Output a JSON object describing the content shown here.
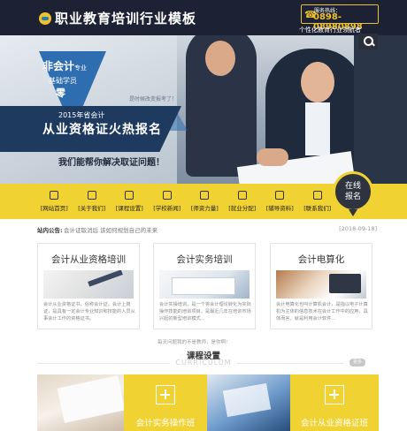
{
  "header": {
    "logo_text": "职业教育培训行业模板",
    "hotline_label": "服务热线：",
    "hotline_number": "0898-08980898",
    "tagline": "个性化教育行业领航者"
  },
  "banner": {
    "tri_line1_main": "非会计",
    "tri_line1_small": "专业",
    "tri_line2": "基础学员",
    "tri_line3": "零",
    "note": "是时候改变报考了！",
    "band_line1": "2015年省会计",
    "band_line2": "从业资格证火热报名",
    "help_text": "我们能帮你解决取证问题！"
  },
  "nav": {
    "items": [
      {
        "label": "[网站首页]",
        "icon": "home-icon"
      },
      {
        "label": "[关于我们]",
        "icon": "info-icon"
      },
      {
        "label": "[课程设置]",
        "icon": "book-icon"
      },
      {
        "label": "[学校新闻]",
        "icon": "news-icon"
      },
      {
        "label": "[师资力量]",
        "icon": "teacher-icon"
      },
      {
        "label": "[就业分配]",
        "icon": "phone-icon"
      },
      {
        "label": "[辅导资料]",
        "icon": "document-icon"
      },
      {
        "label": "[联系我们]",
        "icon": "mail-icon"
      }
    ],
    "online_line1": "在线",
    "online_line2": "报名"
  },
  "notice": {
    "label": "站内公告:",
    "text": "会计证取消后 该如何规划自己的未来",
    "date": "[2018-09-18]"
  },
  "cards": [
    {
      "title": "会计从业资格培训",
      "desc": "会计从业资格证书，俗称会计证，会计上岗证，是具有一定会计专业知识和技能的人员从事会计工作的资格证书。"
    },
    {
      "title": "会计实务培训",
      "desc": "会计实操培训，是一个将会计理论转化为实际操作技能的培训项目，是最近几年在培训市场兴起的新型培训模式..."
    },
    {
      "title": "会计电算化",
      "desc": "会计电算化也叫计算机会计，是指以电子计算机为主体的信息技术在会计工作中的应用，具体而言，就是利用会计软件..."
    }
  ],
  "courses": {
    "note": "每天问题我的不是教师，是你啊!",
    "title": "课程设置",
    "subtitle": "CURRICULUM",
    "more_label": "更多",
    "tiles": [
      {
        "label": "会计实务操作班"
      },
      {
        "label": "会计从业资格证班"
      }
    ]
  },
  "colors": {
    "header_bg": "#1c2233",
    "accent_yellow": "#f1d233",
    "banner_blue": "#2e6db0"
  }
}
